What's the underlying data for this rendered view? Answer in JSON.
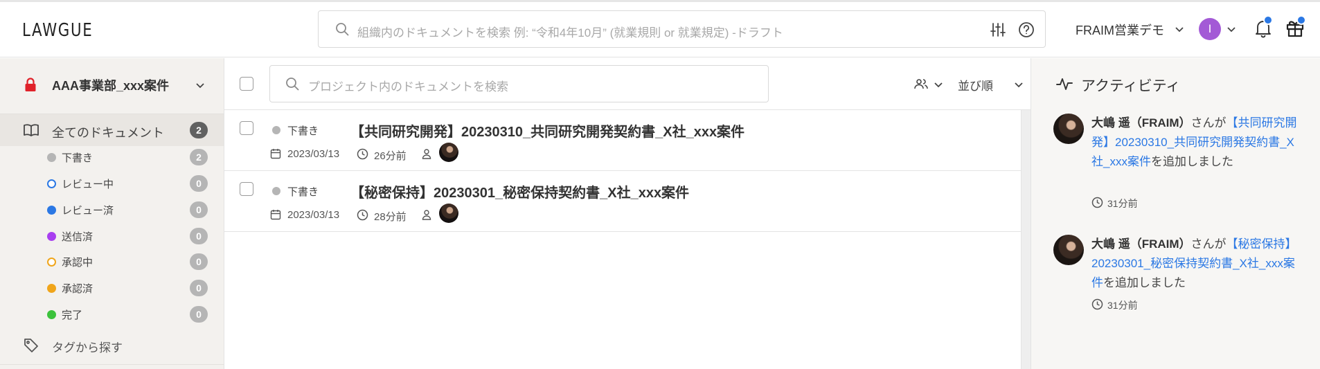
{
  "header": {
    "logo": "LAWGUE",
    "search_placeholder": "組織内のドキュメントを検索 例: “令和4年10月” (就業規則 or 就業規定) -ドラフト",
    "org_name": "FRAIM営業デモ",
    "user_initial": "I",
    "notification_dot_color": "#2b78e4"
  },
  "sidebar": {
    "project_name": "AAA事業部_xxx案件",
    "all_docs": {
      "label": "全てのドキュメント",
      "count": "2"
    },
    "statuses": [
      {
        "label": "下書き",
        "count": "2",
        "color": "#b5b5b5",
        "filled": true
      },
      {
        "label": "レビュー中",
        "count": "0",
        "color": "#2b78e4",
        "filled": false
      },
      {
        "label": "レビュー済",
        "count": "0",
        "color": "#2b78e4",
        "filled": true
      },
      {
        "label": "送信済",
        "count": "0",
        "color": "#a83ff0",
        "filled": true
      },
      {
        "label": "承認中",
        "count": "0",
        "color": "#f0a51a",
        "filled": false
      },
      {
        "label": "承認済",
        "count": "0",
        "color": "#f0a51a",
        "filled": true
      },
      {
        "label": "完了",
        "count": "0",
        "color": "#3cc23c",
        "filled": true
      }
    ],
    "tags_label": "タグから探す"
  },
  "main": {
    "search_placeholder": "プロジェクト内のドキュメントを検索",
    "sort_label": "並び順",
    "documents": [
      {
        "status": "下書き",
        "title": "【共同研究開発】20230310_共同研究開発契約書_X社_xxx案件",
        "date": "2023/03/13",
        "ago": "26分前"
      },
      {
        "status": "下書き",
        "title": "【秘密保持】20230301_秘密保持契約書_X社_xxx案件",
        "date": "2023/03/13",
        "ago": "28分前"
      }
    ]
  },
  "activity": {
    "title": "アクティビティ",
    "items": [
      {
        "user": "大嶋 遥（FRAIM）",
        "prefix": "さんが",
        "doc": "【共同研究開発】20230310_共同研究開発契約書_X社_xxx案件",
        "suffix": "を追加しました",
        "time": "31分前"
      },
      {
        "user": "大嶋 遥（FRAIM）",
        "prefix": "さんが",
        "doc": "【秘密保持】20230301_秘密保持契約書_X社_xxx案件",
        "suffix": "を追加しました",
        "time": "31分前"
      }
    ]
  }
}
